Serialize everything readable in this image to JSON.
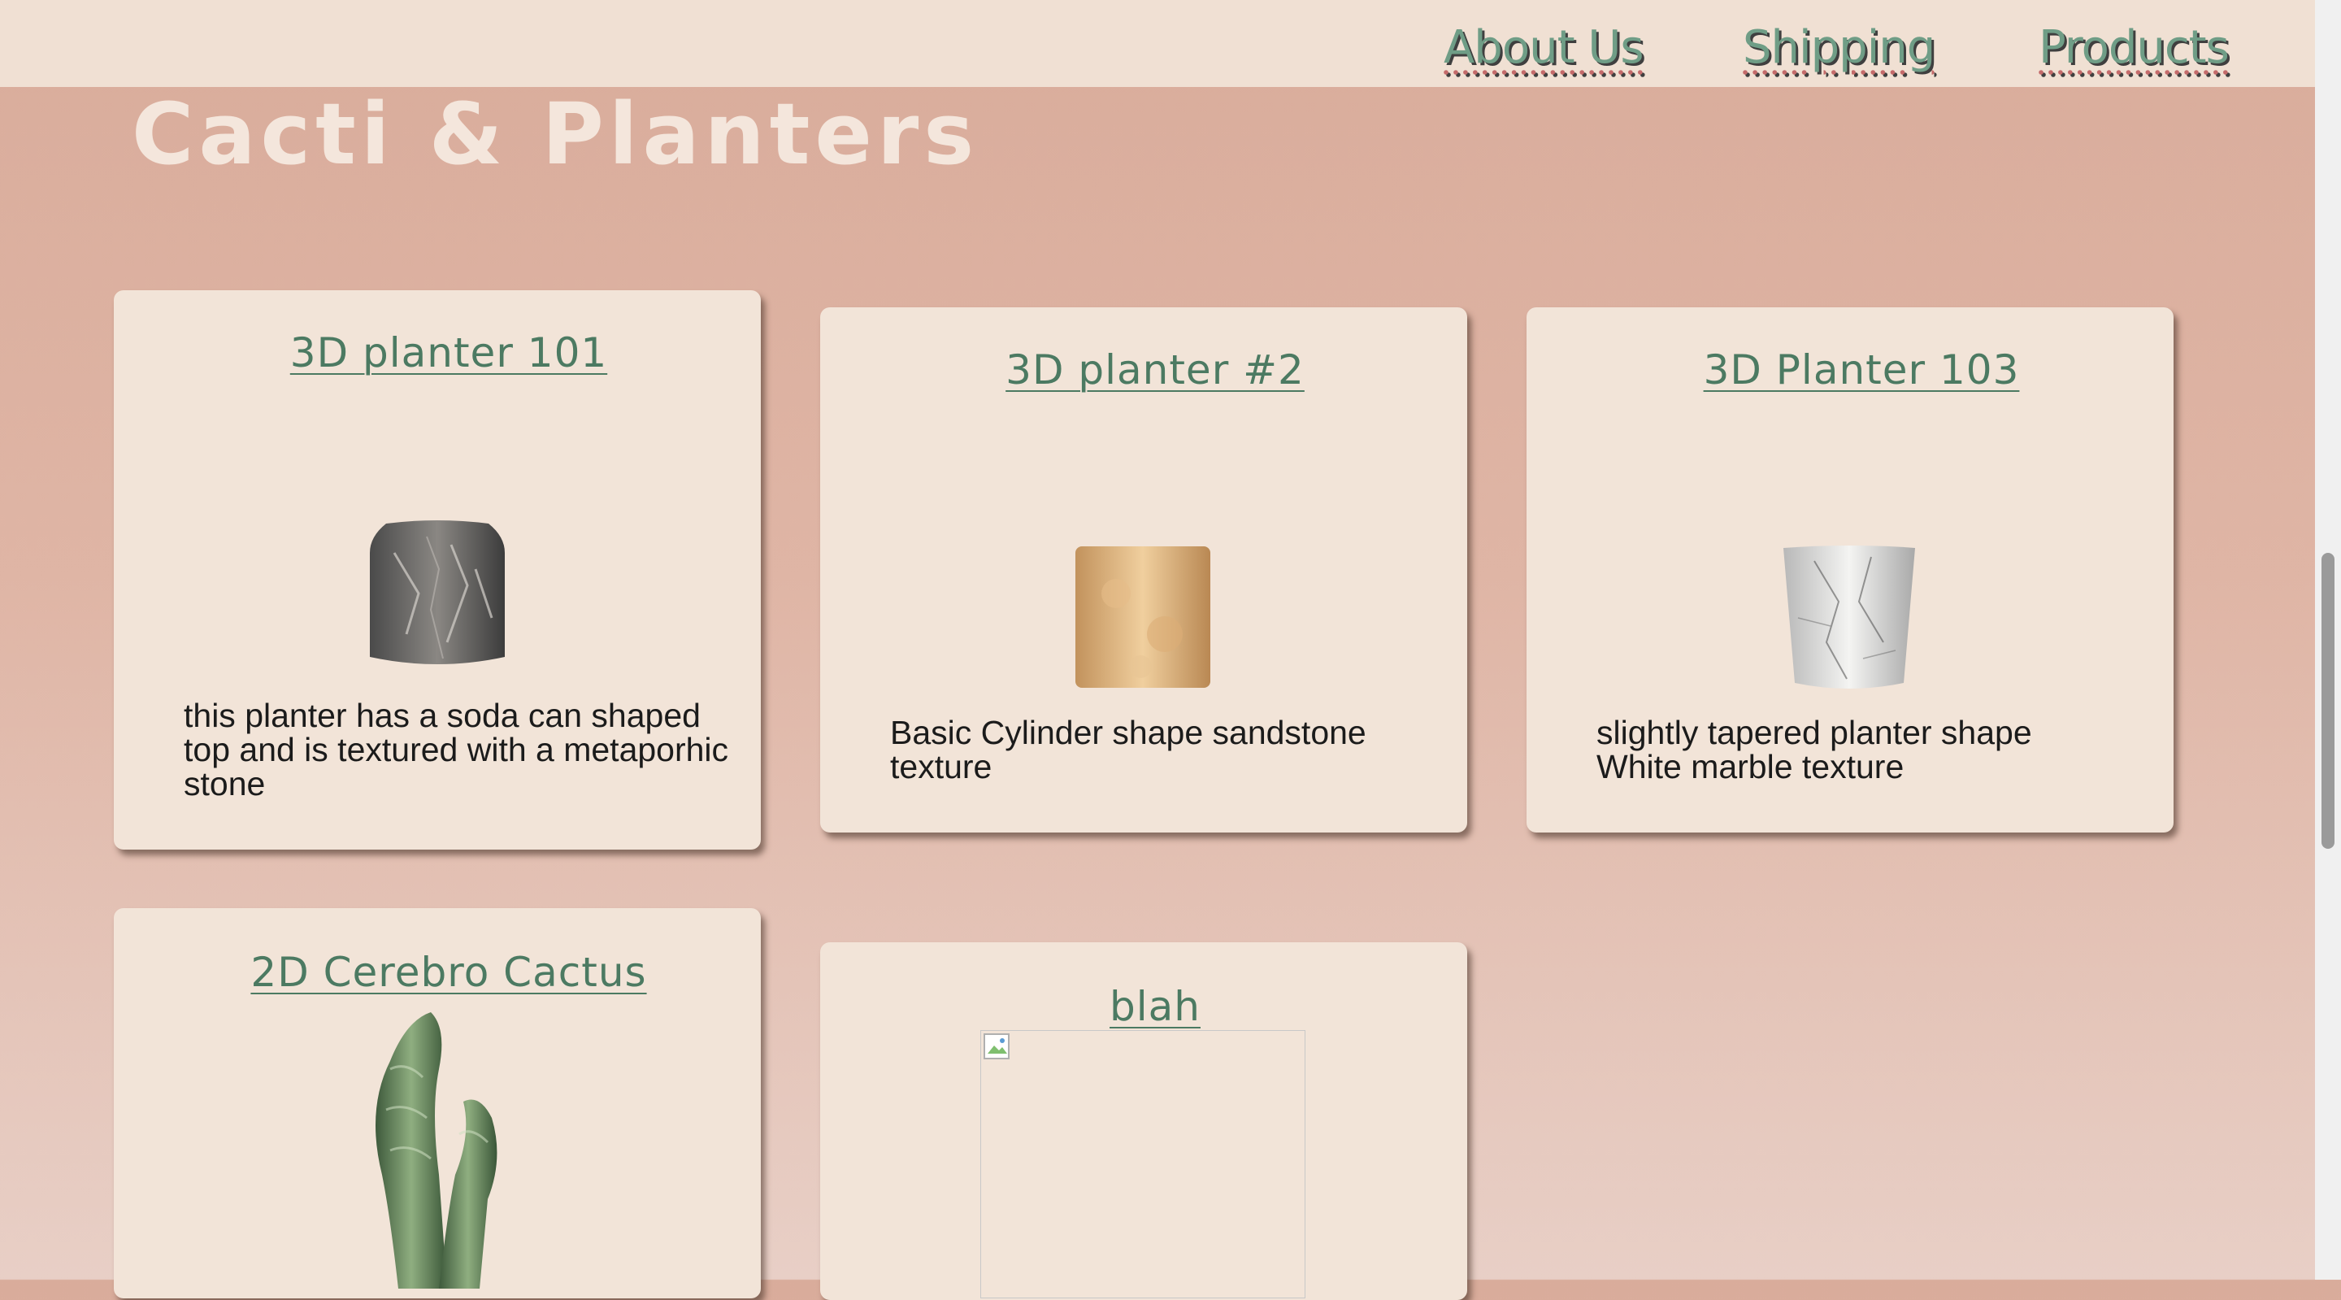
{
  "nav": {
    "links": [
      "About Us",
      "Shipping",
      "Products"
    ]
  },
  "page": {
    "title": "Cacti & Planters"
  },
  "products": [
    {
      "name": "3D planter 101",
      "description": "this planter has a soda can shaped top and is textured with a metaporhic stone"
    },
    {
      "name": "3D planter #2",
      "description": "Basic Cylinder shape sandstone texture"
    },
    {
      "name": "3D Planter 103",
      "description": "slightly tapered planter shape\nWhite marble texture"
    },
    {
      "name": "2D Cerebro Cactus",
      "description": ""
    },
    {
      "name": "blah",
      "description": ""
    }
  ],
  "colors": {
    "nav_bg": "#f0e0d3",
    "page_bg": "#dbb0a0",
    "card_bg": "#f2e4d8",
    "link_green": "#4c7a62"
  },
  "icons": [
    "broken-image-icon"
  ]
}
